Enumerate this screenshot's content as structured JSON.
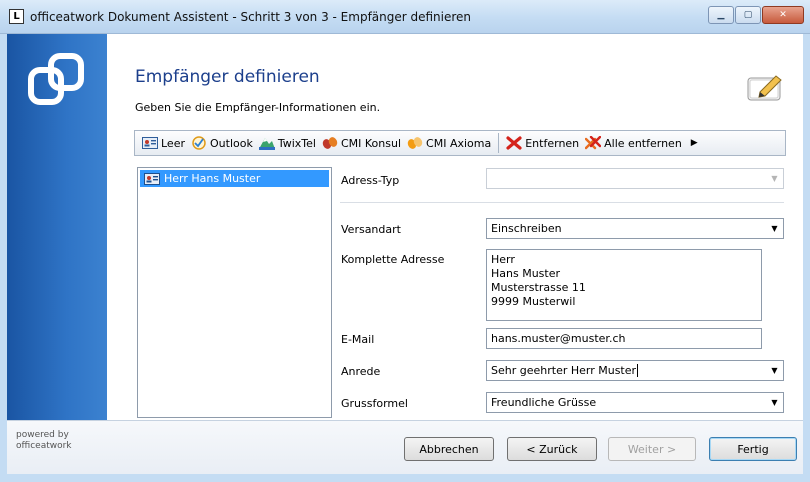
{
  "window": {
    "title": "officeatwork Dokument Assistent - Schritt 3 von 3 - Empfänger definieren",
    "app_icon_letter": "L",
    "minimize_glyph": "▁",
    "maximize_glyph": "▢",
    "close_glyph": "✕"
  },
  "header": {
    "title": "Empfänger definieren",
    "subtitle": "Geben Sie die Empfänger-Informationen ein."
  },
  "toolbar": {
    "items": [
      {
        "label": "Leer",
        "icon": "contact-card-icon"
      },
      {
        "label": "Outlook",
        "icon": "outlook-icon"
      },
      {
        "label": "TwixTel",
        "icon": "twixtel-icon"
      },
      {
        "label": "CMI Konsul",
        "icon": "cmi-konsul-icon"
      },
      {
        "label": "CMI Axioma",
        "icon": "cmi-axioma-icon"
      },
      {
        "label": "Entfernen",
        "icon": "red-x-icon"
      },
      {
        "label": "Alle entfernen",
        "icon": "red-x-multi-icon"
      }
    ],
    "more_glyph": "▶"
  },
  "recipients": {
    "items": [
      {
        "label": "Herr Hans Muster",
        "selected": true
      }
    ]
  },
  "form": {
    "adress_typ": {
      "label": "Adress-Typ",
      "value": ""
    },
    "versandart": {
      "label": "Versandart",
      "value": "Einschreiben"
    },
    "adresse": {
      "label": "Komplette Adresse",
      "value": "Herr\nHans Muster\nMusterstrasse 11\n9999 Musterwil"
    },
    "email": {
      "label": "E-Mail",
      "value": "hans.muster@muster.ch"
    },
    "anrede": {
      "label": "Anrede",
      "value": "Sehr geehrter Herr Muster"
    },
    "grussformel": {
      "label": "Grussformel",
      "value": "Freundliche Grüsse"
    },
    "combo_glyph": "▼"
  },
  "footer": {
    "powered_line1": "powered by",
    "powered_line2": "officeatwork"
  },
  "buttons": {
    "cancel": "Abbrechen",
    "back": "< Zurück",
    "next": "Weiter >",
    "finish": "Fertig"
  },
  "colors": {
    "accent_blue": "#2f74c6",
    "selection": "#3399ff",
    "title_blue": "#1c3f8c"
  }
}
